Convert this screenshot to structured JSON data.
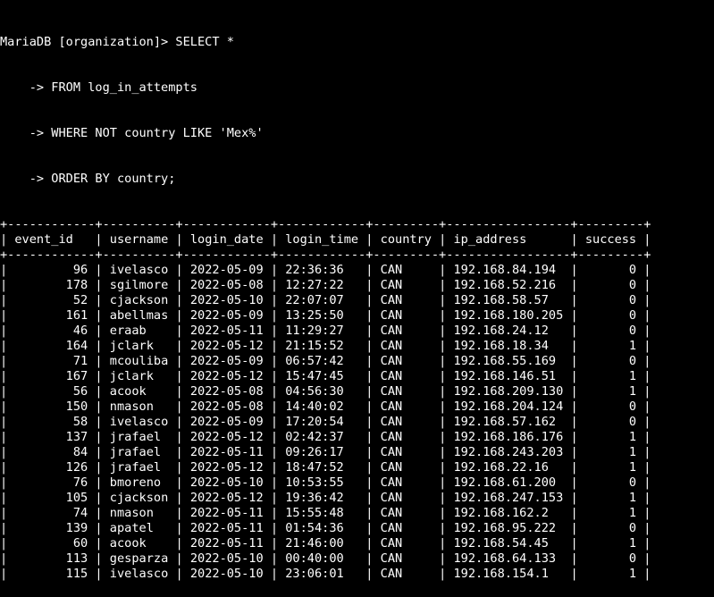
{
  "terminal": {
    "prompt": "MariaDB [organization]> ",
    "query_lines": [
      "SELECT *",
      "    -> FROM log_in_attempts",
      "    -> WHERE NOT country LIKE 'Mex%'",
      "    -> ORDER BY country;"
    ]
  },
  "table": {
    "columns": [
      {
        "name": "event_id",
        "width": 10,
        "align": "right"
      },
      {
        "name": "username",
        "width": 8,
        "align": "left"
      },
      {
        "name": "login_date",
        "width": 10,
        "align": "left"
      },
      {
        "name": "login_time",
        "width": 10,
        "align": "left"
      },
      {
        "name": "country",
        "width": 7,
        "align": "left"
      },
      {
        "name": "ip_address",
        "width": 15,
        "align": "left"
      },
      {
        "name": "success",
        "width": 7,
        "align": "right"
      }
    ],
    "rows": [
      [
        "96",
        "ivelasco",
        "2022-05-09",
        "22:36:36",
        "CAN",
        "192.168.84.194",
        "0"
      ],
      [
        "178",
        "sgilmore",
        "2022-05-08",
        "12:27:22",
        "CAN",
        "192.168.52.216",
        "0"
      ],
      [
        "52",
        "cjackson",
        "2022-05-10",
        "22:07:07",
        "CAN",
        "192.168.58.57",
        "0"
      ],
      [
        "161",
        "abellmas",
        "2022-05-09",
        "13:25:50",
        "CAN",
        "192.168.180.205",
        "0"
      ],
      [
        "46",
        "eraab",
        "2022-05-11",
        "11:29:27",
        "CAN",
        "192.168.24.12",
        "0"
      ],
      [
        "164",
        "jclark",
        "2022-05-12",
        "21:15:52",
        "CAN",
        "192.168.18.34",
        "1"
      ],
      [
        "71",
        "mcouliba",
        "2022-05-09",
        "06:57:42",
        "CAN",
        "192.168.55.169",
        "0"
      ],
      [
        "167",
        "jclark",
        "2022-05-12",
        "15:47:45",
        "CAN",
        "192.168.146.51",
        "1"
      ],
      [
        "56",
        "acook",
        "2022-05-08",
        "04:56:30",
        "CAN",
        "192.168.209.130",
        "1"
      ],
      [
        "150",
        "nmason",
        "2022-05-08",
        "14:40:02",
        "CAN",
        "192.168.204.124",
        "0"
      ],
      [
        "58",
        "ivelasco",
        "2022-05-09",
        "17:20:54",
        "CAN",
        "192.168.57.162",
        "0"
      ],
      [
        "137",
        "jrafael",
        "2022-05-12",
        "02:42:37",
        "CAN",
        "192.168.186.176",
        "1"
      ],
      [
        "84",
        "jrafael",
        "2022-05-11",
        "09:26:17",
        "CAN",
        "192.168.243.203",
        "1"
      ],
      [
        "126",
        "jrafael",
        "2022-05-12",
        "18:47:52",
        "CAN",
        "192.168.22.16",
        "1"
      ],
      [
        "76",
        "bmoreno",
        "2022-05-10",
        "10:53:55",
        "CAN",
        "192.168.61.200",
        "0"
      ],
      [
        "105",
        "cjackson",
        "2022-05-12",
        "19:36:42",
        "CAN",
        "192.168.247.153",
        "1"
      ],
      [
        "74",
        "nmason",
        "2022-05-11",
        "15:55:48",
        "CAN",
        "192.168.162.2",
        "1"
      ],
      [
        "139",
        "apatel",
        "2022-05-11",
        "01:54:36",
        "CAN",
        "192.168.95.222",
        "0"
      ],
      [
        "60",
        "acook",
        "2022-05-11",
        "21:46:00",
        "CAN",
        "192.168.54.45",
        "1"
      ],
      [
        "113",
        "gesparza",
        "2022-05-10",
        "00:40:00",
        "CAN",
        "192.168.64.133",
        "0"
      ],
      [
        "115",
        "ivelasco",
        "2022-05-10",
        "23:06:01",
        "CAN",
        "192.168.154.1",
        "1"
      ]
    ]
  }
}
